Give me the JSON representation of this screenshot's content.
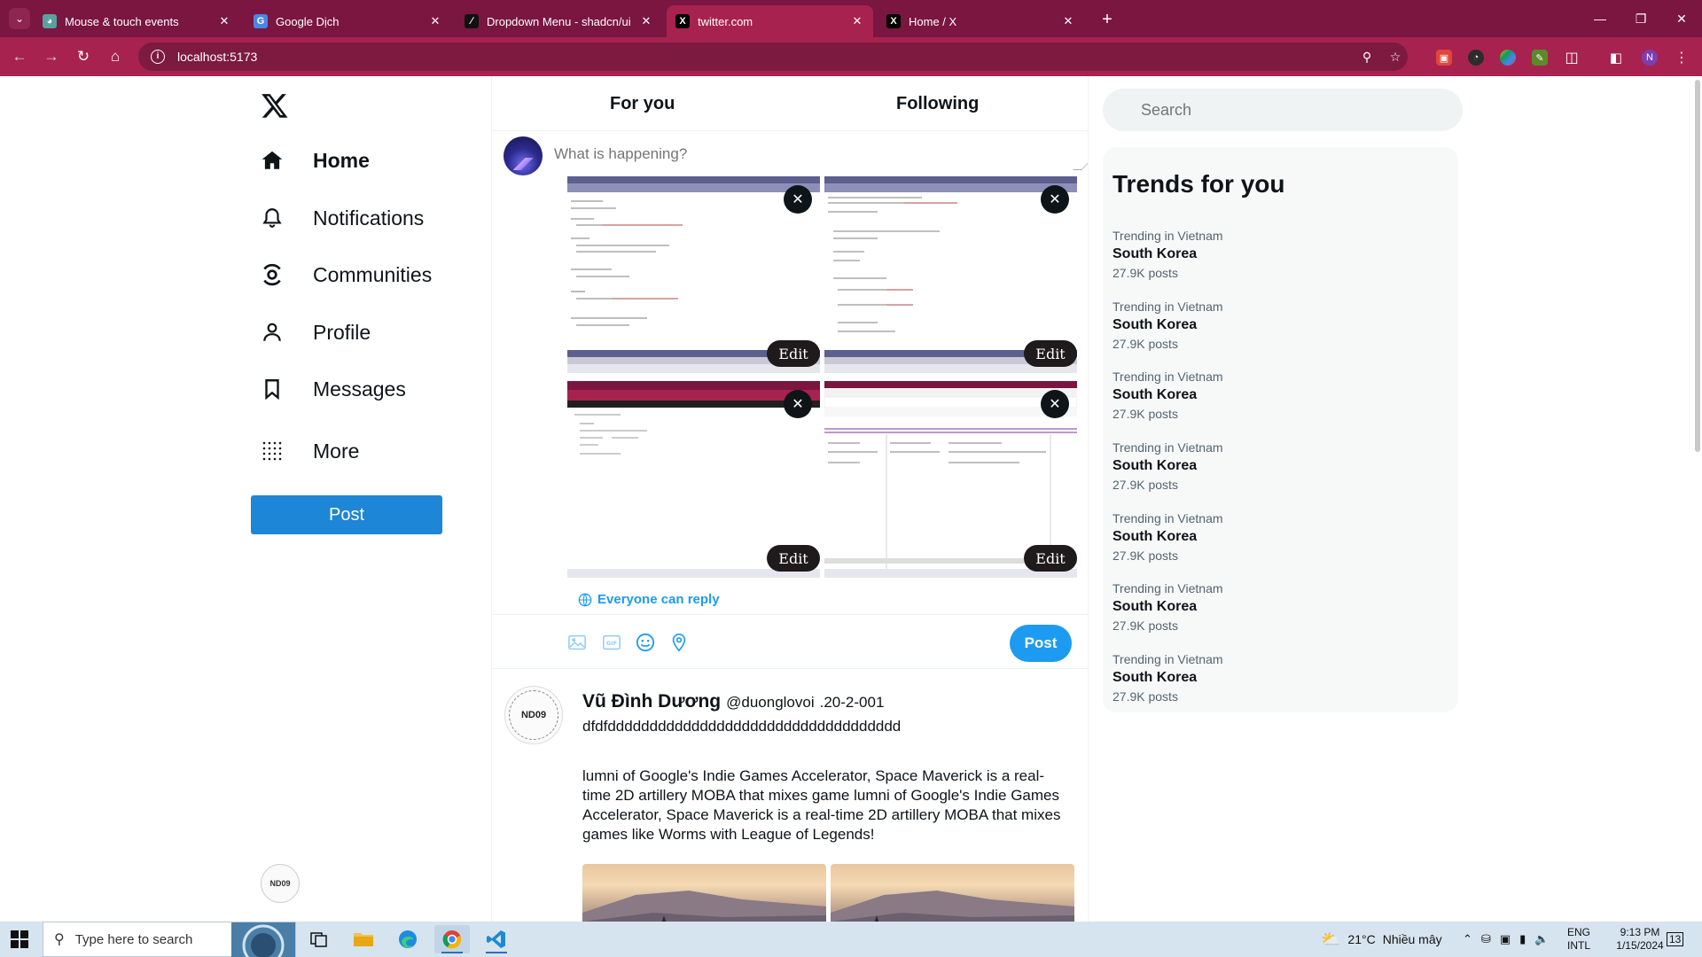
{
  "browser": {
    "tabs": [
      {
        "label": "Mouse & touch events",
        "favicon": "globe-icon",
        "active": false
      },
      {
        "label": "Google Dịch",
        "favicon": "google-translate-icon",
        "active": false
      },
      {
        "label": "Dropdown Menu - shadcn/ui",
        "favicon": "shadcn-icon",
        "active": false
      },
      {
        "label": "twitter.com",
        "favicon": "x-logo-icon",
        "active": true
      },
      {
        "label": "Home / X",
        "favicon": "x-logo-icon",
        "active": false
      }
    ],
    "url": "localhost:5173",
    "accent_color": "#a8224f",
    "tabbar_color": "#7a1640",
    "profile_initial": "N"
  },
  "sidebar": {
    "logo": "x-logo-icon",
    "items": [
      {
        "label": "Home",
        "icon": "home-icon"
      },
      {
        "label": "Notifications",
        "icon": "bell-icon"
      },
      {
        "label": "Communities",
        "icon": "communities-icon"
      },
      {
        "label": "Profile",
        "icon": "person-icon"
      },
      {
        "label": "Messages",
        "icon": "bookmark-icon"
      },
      {
        "label": "More",
        "icon": "grid-dots-icon"
      }
    ],
    "post_label": "Post",
    "avatar_text": "ND09"
  },
  "feed": {
    "tabs": [
      "For you",
      "Following"
    ],
    "composer": {
      "placeholder": "What is happening?",
      "reply_setting": "Everyone can reply",
      "edit_label": "Edit",
      "post_label": "Post",
      "tools": [
        "image-icon",
        "gif-icon",
        "emoji-icon",
        "location-icon"
      ]
    },
    "tweet": {
      "name": "Vũ Đình Dương",
      "handle": "@duonglovoi",
      "date": ".20-2-001",
      "line1": "dfdfddddddddddddddddddddddddddddddddddd",
      "body": "lumni of Google's Indie Games Accelerator, Space Maverick is a real-time 2D artillery MOBA that mixes game lumni of Google's Indie Games Accelerator, Space Maverick is a real-time 2D artillery MOBA that mixes games like Worms with League of Legends!",
      "avatar_text": "ND09"
    }
  },
  "right": {
    "search_placeholder": "Search",
    "trends_title": "Trends for you",
    "trends": [
      {
        "context": "Trending in Vietnam",
        "topic": "South Korea",
        "count": "27.9K posts"
      },
      {
        "context": "Trending in Vietnam",
        "topic": "South Korea",
        "count": "27.9K posts"
      },
      {
        "context": "Trending in Vietnam",
        "topic": "South Korea",
        "count": "27.9K posts"
      },
      {
        "context": "Trending in Vietnam",
        "topic": "South Korea",
        "count": "27.9K posts"
      },
      {
        "context": "Trending in Vietnam",
        "topic": "South Korea",
        "count": "27.9K posts"
      },
      {
        "context": "Trending in Vietnam",
        "topic": "South Korea",
        "count": "27.9K posts"
      },
      {
        "context": "Trending in Vietnam",
        "topic": "South Korea",
        "count": "27.9K posts"
      }
    ]
  },
  "taskbar": {
    "search_placeholder": "Type here to search",
    "weather_temp": "21°C",
    "weather_desc": "Nhiều mây",
    "lang_top": "ENG",
    "lang_bottom": "INTL",
    "time": "9:13 PM",
    "date": "1/15/2024",
    "notification_count": "13"
  }
}
